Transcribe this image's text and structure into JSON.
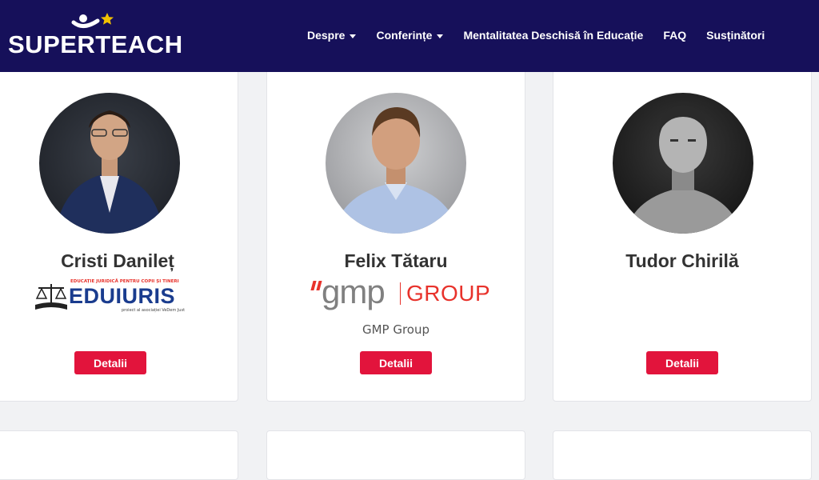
{
  "header": {
    "logo_text": "SUPERTEACH",
    "nav": [
      {
        "label": "Despre",
        "dropdown": true
      },
      {
        "label": "Conferințe",
        "dropdown": true
      },
      {
        "label": "Mentalitatea Deschisă în Educație",
        "dropdown": false
      },
      {
        "label": "FAQ",
        "dropdown": false
      },
      {
        "label": "Susținători",
        "dropdown": false
      }
    ]
  },
  "speakers": [
    {
      "name": "Cristi Danileț",
      "logo": {
        "tagline": "EDUCAȚIE JURIDICĂ PENTRU COPII ȘI TINERI",
        "name": "EDUIURIS",
        "credit": "proiect al asociației VeDem Just"
      },
      "button": "Detalii"
    },
    {
      "name": "Felix Tătaru",
      "logo": {
        "mark": "gmp",
        "text": "GROUP"
      },
      "company": "GMP Group",
      "button": "Detalii"
    },
    {
      "name": "Tudor Chirilă",
      "button": "Detalii"
    }
  ],
  "colors": {
    "navbar": "#16105a",
    "button": "#e2143c",
    "star": "#f2c200",
    "gmp_red": "#e8322b"
  }
}
